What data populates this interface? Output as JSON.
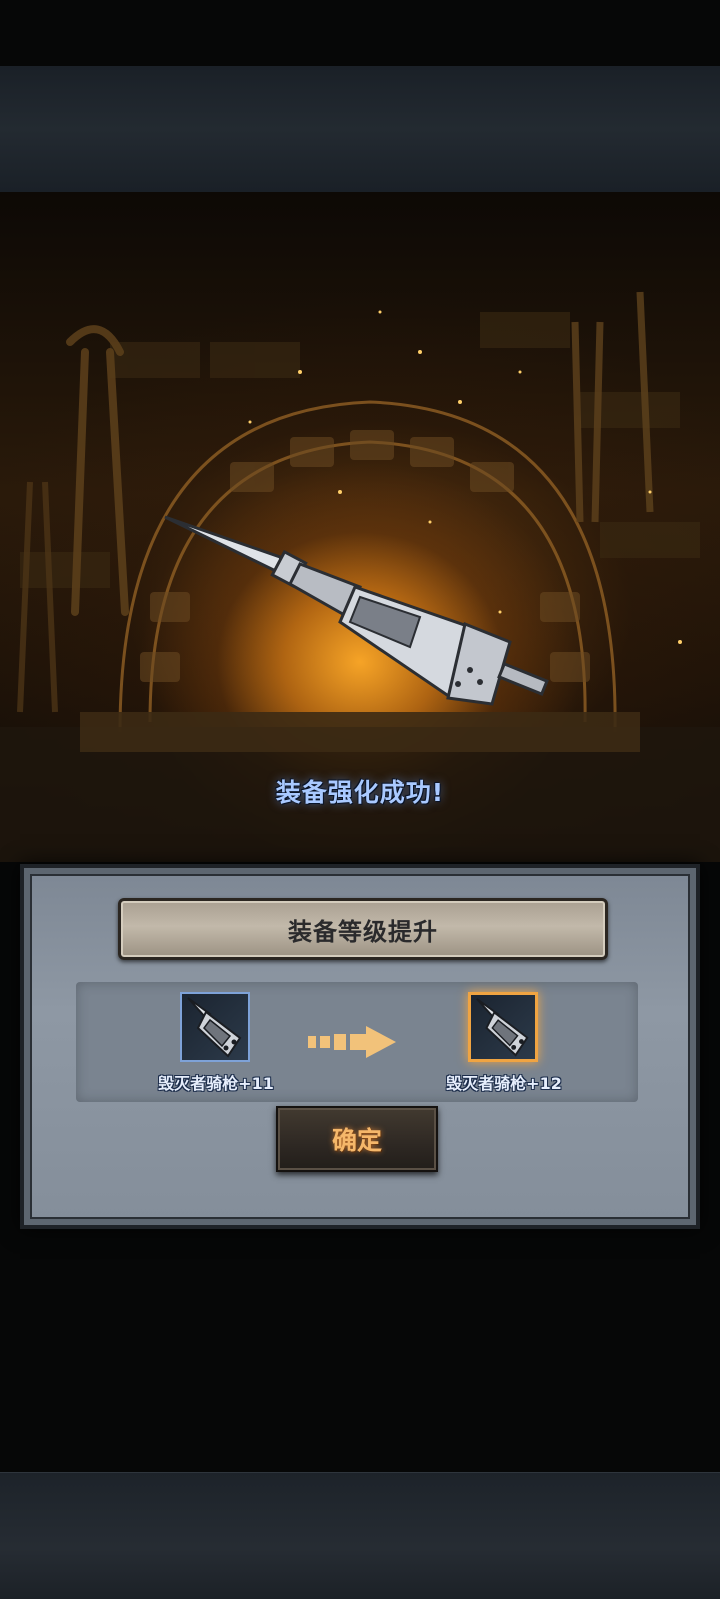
{
  "result_message": "装备强化成功!",
  "dialog": {
    "title": "装备等级提升",
    "old_item": {
      "name": "毁灭者骑枪",
      "level": "+11"
    },
    "new_item": {
      "name": "毁灭者骑枪",
      "level": "+12"
    },
    "confirm_label": "确定"
  },
  "colors": {
    "success_text": "#a9c9ff",
    "confirm_text": "#f5b76a",
    "new_item_border": "#f0a442",
    "old_item_border": "#7ea2d8",
    "arrow": "#f2c27a"
  },
  "icons": {
    "equipment": "lance-icon",
    "progress": "arrow-right-icon"
  }
}
